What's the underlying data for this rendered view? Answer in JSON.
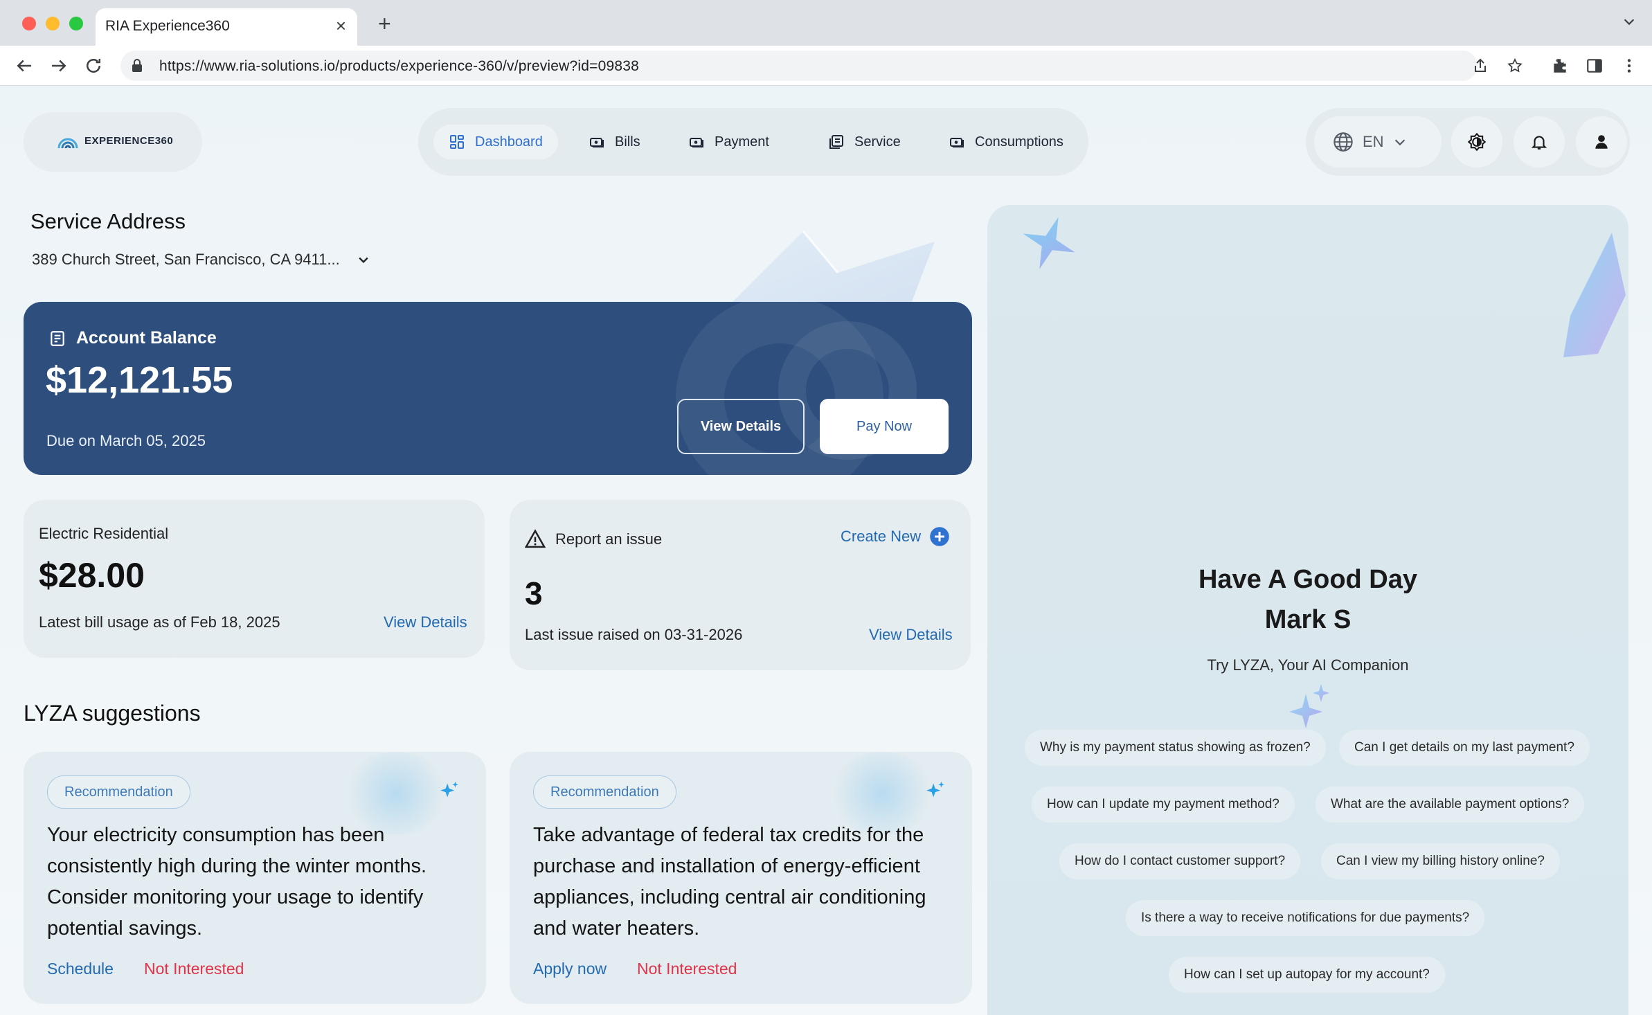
{
  "browser": {
    "tab_title": "RIA Experience360",
    "url": "https://www.ria-solutions.io/products/experience-360/v/preview?id=09838"
  },
  "header": {
    "logo_text": "EXPERIENCE360",
    "nav": [
      {
        "label": "Dashboard",
        "icon": "grid-icon",
        "active": true
      },
      {
        "label": "Bills",
        "icon": "bill-icon",
        "active": false
      },
      {
        "label": "Payment",
        "icon": "payment-icon",
        "active": false
      },
      {
        "label": "Service",
        "icon": "service-icon",
        "active": false
      },
      {
        "label": "Consumptions",
        "icon": "consumption-icon",
        "active": false
      }
    ],
    "language": "EN"
  },
  "service": {
    "title": "Service Address",
    "address": "389 Church Street, San Francisco, CA 9411..."
  },
  "balance": {
    "label": "Account Balance",
    "amount": "$12,121.55",
    "due": "Due on March 05, 2025",
    "view_details": "View Details",
    "pay_now": "Pay Now"
  },
  "electric": {
    "label": "Electric Residential",
    "amount": "$28.00",
    "sub": "Latest bill usage as of Feb 18, 2025",
    "link": "View Details"
  },
  "issue": {
    "label": "Report an issue",
    "create": "Create New",
    "count": "3",
    "sub": "Last issue raised on 03-31-2026",
    "link": "View Details"
  },
  "lyza": {
    "title": "LYZA suggestions",
    "cards": [
      {
        "badge": "Recommendation",
        "text": "Your electricity consumption has been consistently high during the winter months. Consider monitoring your usage to identify potential savings.",
        "action": "Schedule",
        "dismiss": "Not Interested"
      },
      {
        "badge": "Recommendation",
        "text": "Take advantage of federal tax credits for the purchase and installation of energy-efficient appliances, including central air conditioning and water heaters.",
        "action": "Apply now",
        "dismiss": "Not Interested"
      }
    ]
  },
  "ai": {
    "greeting_line1": "Have A Good Day",
    "greeting_line2": "Mark S",
    "try": "Try LYZA, Your AI Companion",
    "chips": [
      "Why is my payment status showing as frozen?",
      "Can I get details on my last payment?",
      "How can I update my payment method?",
      "What are the available payment options?",
      "How do I contact customer support?",
      "Can I view my billing history online?",
      "Is there a way to receive notifications for due payments?",
      "How can I set up autopay for my account?"
    ]
  },
  "colors": {
    "primary": "#2e4f7e",
    "link": "#2269b0",
    "danger": "#e0334a",
    "nav_active": "#2f6fd0"
  }
}
